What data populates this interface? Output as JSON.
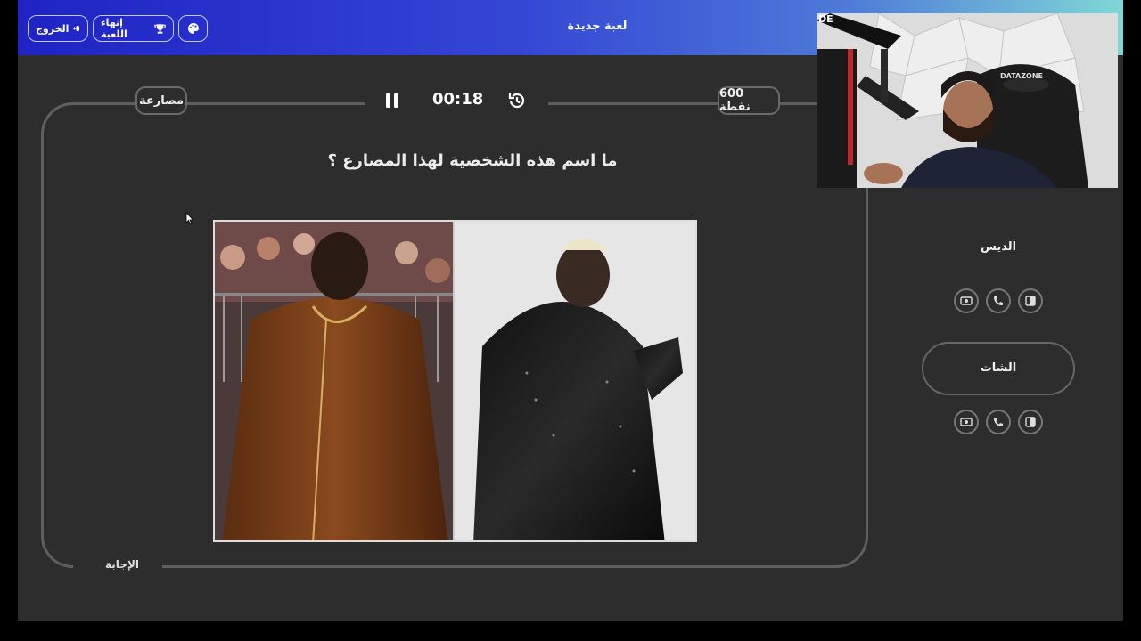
{
  "header": {
    "title": "لعبة جديدة",
    "exit_label": "الخروج",
    "end_game_label": "إنهاء اللعبة",
    "palette_icon": "palette-icon",
    "colors": {
      "gradient_start": "#1f23c4",
      "gradient_end": "#7fd8d6"
    }
  },
  "board": {
    "points_label": "600 نقطة",
    "timer": "00:18",
    "category_label": "مصارعة",
    "question": "ما اسم هذه الشخصية لهذا المصارع ؟",
    "answer_label": "الإجابة",
    "pause_icon": "pause-icon",
    "reset_icon": "history-icon"
  },
  "teams": [
    {
      "name": "الديس",
      "aids": [
        "double-points-icon",
        "phone-call-icon",
        "split-answer-icon"
      ]
    },
    {
      "name": "الشات",
      "aids": [
        "double-points-icon",
        "phone-call-icon",
        "split-answer-icon"
      ]
    }
  ],
  "webcam": {
    "brand_text": "DATAZONE",
    "sign_text": "DE"
  },
  "colors": {
    "background": "#2d2d2d",
    "border": "#5f5f5f",
    "text": "#ececec"
  }
}
